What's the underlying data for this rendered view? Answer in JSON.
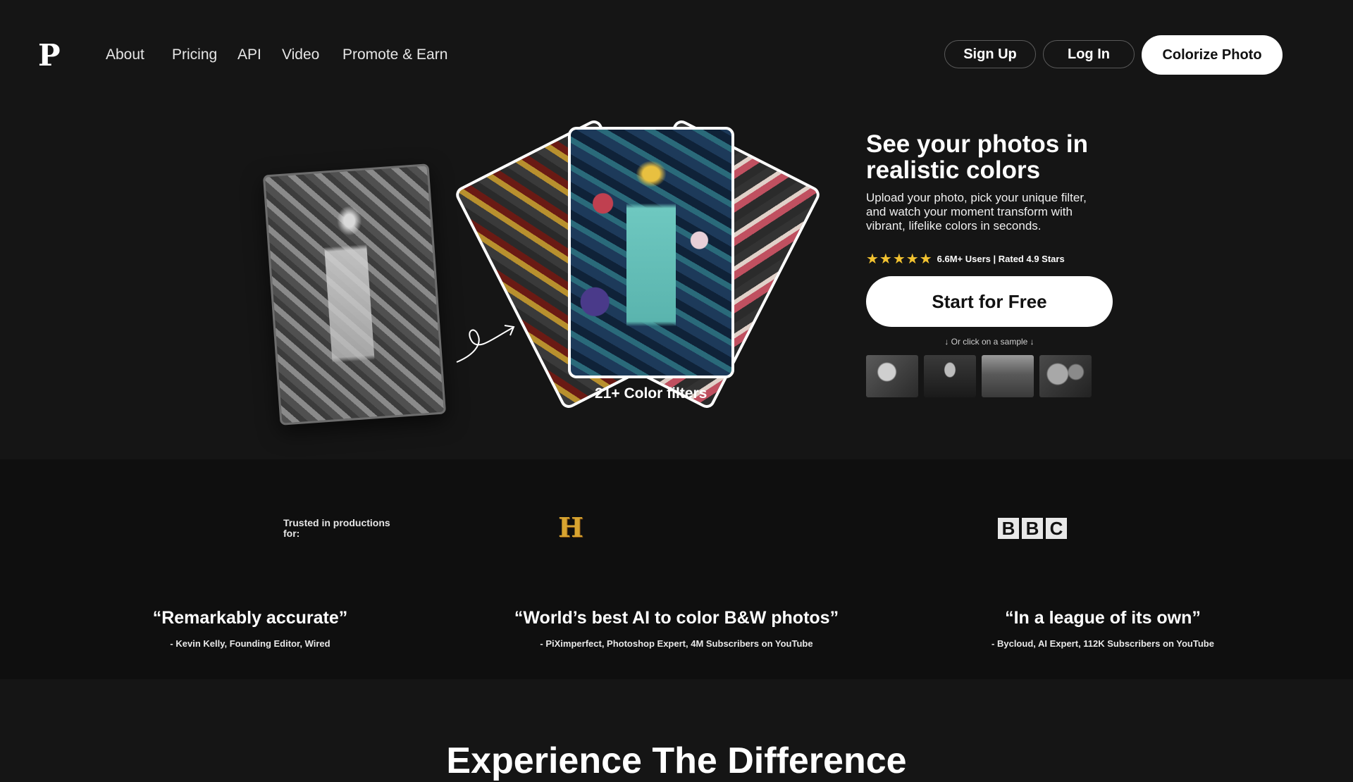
{
  "header": {
    "logo": "P",
    "nav": [
      "About",
      "Pricing",
      "API",
      "Video",
      "Promote & Earn"
    ],
    "signup": "Sign Up",
    "login": "Log In",
    "colorize": "Colorize Photo"
  },
  "hero": {
    "filters_label": "21+ Color filters",
    "title": "See your photos in realistic colors",
    "subtitle": "Upload your photo, pick your unique filter, and watch your moment transform with vibrant, lifelike colors in seconds.",
    "stars": "★★★★★",
    "rating_text": "6.6M+ Users | Rated 4.9 Stars",
    "cta": "Start for Free",
    "sample_hint": "↓ Or click on a sample ↓"
  },
  "trusted": {
    "label": "Trusted in productions for:",
    "history_logo": "H",
    "bbc": [
      "B",
      "B",
      "C"
    ]
  },
  "quotes": [
    {
      "text": "“Remarkably accurate”",
      "by": "- Kevin Kelly, Founding Editor, Wired"
    },
    {
      "text": "“World’s best AI to color B&W photos”",
      "by": "- PiXimperfect, Photoshop Expert, 4M Subscribers on YouTube"
    },
    {
      "text": "“In a league of its own”",
      "by": "- Bycloud, AI Expert, 112K Subscribers on YouTube"
    }
  ],
  "section": {
    "title": "Experience The Difference"
  },
  "colors": {
    "background": "#151515",
    "band": "#0f0f0f",
    "stars": "#f2c230"
  }
}
